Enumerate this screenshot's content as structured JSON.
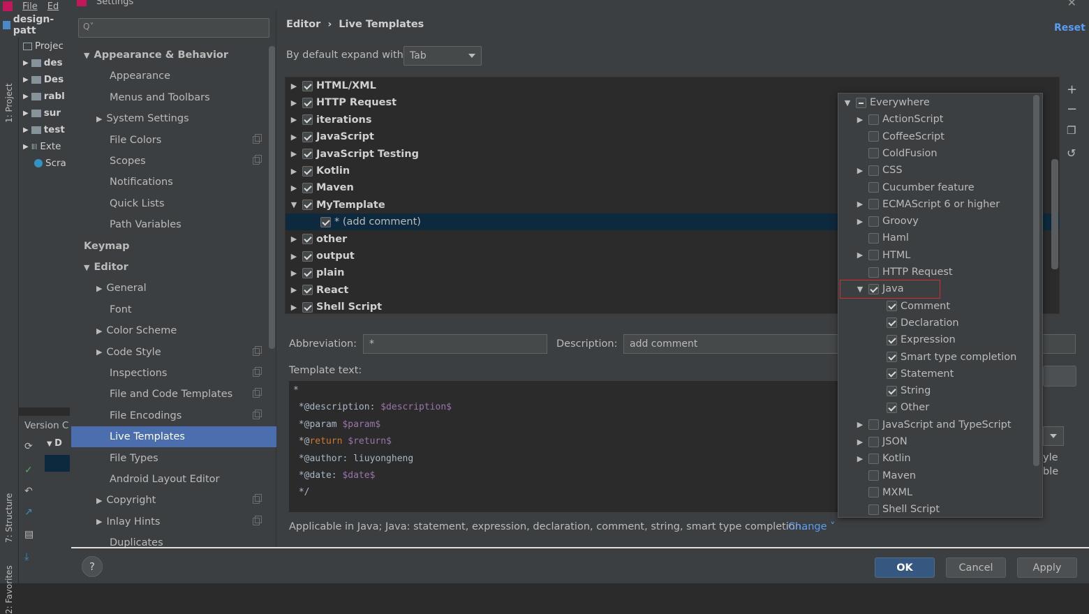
{
  "ide": {
    "menu": [
      "File",
      "Ed"
    ],
    "project_name": "design-patt",
    "stripe_project": "1: Project",
    "stripe_structure": "7: Structure",
    "stripe_favorites": "2: Favorites",
    "tree": [
      {
        "label": "Projec",
        "icon": "project-view-icon"
      },
      {
        "label": "des",
        "icon": "folder-icon"
      },
      {
        "label": "Des",
        "icon": "folder-icon"
      },
      {
        "label": "rabl",
        "icon": "folder-icon"
      },
      {
        "label": "sur",
        "icon": "folder-icon"
      },
      {
        "label": "test",
        "icon": "folder-icon"
      },
      {
        "label": "Exte",
        "icon": "library-icon"
      },
      {
        "label": "Scra",
        "icon": "scratches-icon"
      }
    ],
    "version_control": "Version C",
    "vc_row": "D"
  },
  "dialog": {
    "title": "Settings",
    "search": {
      "placeholder": "Q˅"
    },
    "nav": [
      {
        "label": "Appearance & Behavior",
        "level": 0,
        "bold": true,
        "arrow": "▼"
      },
      {
        "label": "Appearance",
        "level": 1
      },
      {
        "label": "Menus and Toolbars",
        "level": 1
      },
      {
        "label": "System Settings",
        "level": 1,
        "arrow": "▶"
      },
      {
        "label": "File Colors",
        "level": 1,
        "copy": true
      },
      {
        "label": "Scopes",
        "level": 1,
        "copy": true
      },
      {
        "label": "Notifications",
        "level": 1
      },
      {
        "label": "Quick Lists",
        "level": 1
      },
      {
        "label": "Path Variables",
        "level": 1
      },
      {
        "label": "Keymap",
        "level": 0,
        "bold": true
      },
      {
        "label": "Editor",
        "level": 0,
        "bold": true,
        "arrow": "▼"
      },
      {
        "label": "General",
        "level": 1,
        "arrow": "▶"
      },
      {
        "label": "Font",
        "level": 1
      },
      {
        "label": "Color Scheme",
        "level": 1,
        "arrow": "▶"
      },
      {
        "label": "Code Style",
        "level": 1,
        "arrow": "▶",
        "copy": true
      },
      {
        "label": "Inspections",
        "level": 1,
        "copy": true
      },
      {
        "label": "File and Code Templates",
        "level": 1,
        "copy": true
      },
      {
        "label": "File Encodings",
        "level": 1,
        "copy": true
      },
      {
        "label": "Live Templates",
        "level": 1,
        "selected": true
      },
      {
        "label": "File Types",
        "level": 1
      },
      {
        "label": "Android Layout Editor",
        "level": 1
      },
      {
        "label": "Copyright",
        "level": 1,
        "arrow": "▶",
        "copy": true
      },
      {
        "label": "Inlay Hints",
        "level": 1,
        "arrow": "▶",
        "copy": true
      },
      {
        "label": "Duplicates",
        "level": 1
      }
    ],
    "breadcrumb": {
      "parent": "Editor",
      "sep": "›",
      "current": "Live Templates"
    },
    "reset": "Reset",
    "expand_label": "By default expand with",
    "expand_value": "Tab",
    "templates": [
      {
        "label": "HTML/XML",
        "arrow": "▶"
      },
      {
        "label": "HTTP Request",
        "arrow": "▶"
      },
      {
        "label": "iterations",
        "arrow": "▶"
      },
      {
        "label": "JavaScript",
        "arrow": "▶"
      },
      {
        "label": "JavaScript Testing",
        "arrow": "▶"
      },
      {
        "label": "Kotlin",
        "arrow": "▶"
      },
      {
        "label": "Maven",
        "arrow": "▶"
      },
      {
        "label": "MyTemplate",
        "arrow": "▼"
      },
      {
        "label": "* (add comment)",
        "child": true
      },
      {
        "label": "other",
        "arrow": "▶"
      },
      {
        "label": "output",
        "arrow": "▶"
      },
      {
        "label": "plain",
        "arrow": "▶"
      },
      {
        "label": "React",
        "arrow": "▶"
      },
      {
        "label": "Shell Script",
        "arrow": "▶"
      }
    ],
    "tools": [
      "add-icon",
      "remove-icon",
      "copy-icon",
      "restore-icon"
    ],
    "abbreviation_label": "Abbreviation:",
    "abbreviation_value": "*",
    "description_label": "Description:",
    "description_value": "add comment",
    "template_text_label": "Template text:",
    "template_lines": [
      [
        {
          "t": "*"
        }
      ],
      [
        {
          "t": " *@description: "
        },
        {
          "t": "$description$",
          "c": "var"
        }
      ],
      [
        {
          "t": " *@param "
        },
        {
          "t": "$param$",
          "c": "var"
        }
      ],
      [
        {
          "t": " *@"
        },
        {
          "t": "return",
          "c": "kw"
        },
        {
          "t": " "
        },
        {
          "t": "$return$",
          "c": "var"
        }
      ],
      [
        {
          "t": " *@author: liuyongheng"
        }
      ],
      [
        {
          "t": " *@date: "
        },
        {
          "t": "$date$",
          "c": "var"
        }
      ],
      [
        {
          "t": " */"
        }
      ]
    ],
    "applicable": "Applicable in Java; Java: statement, expression, declaration, comment, string, smart type completion...",
    "change": "Change ˅",
    "right_fragments": [
      "yle",
      "ble"
    ],
    "buttons": {
      "help": "?",
      "ok": "OK",
      "cancel": "Cancel",
      "apply": "Apply"
    }
  },
  "contexts": [
    {
      "label": "Everywhere",
      "level": 0,
      "arrow": "▼",
      "state": "partial"
    },
    {
      "label": "ActionScript",
      "level": 1,
      "arrow": "▶",
      "state": "off"
    },
    {
      "label": "CoffeeScript",
      "level": 1,
      "state": "off"
    },
    {
      "label": "ColdFusion",
      "level": 1,
      "state": "off"
    },
    {
      "label": "CSS",
      "level": 1,
      "arrow": "▶",
      "state": "off"
    },
    {
      "label": "Cucumber feature",
      "level": 1,
      "state": "off"
    },
    {
      "label": "ECMAScript 6 or higher",
      "level": 1,
      "arrow": "▶",
      "state": "off"
    },
    {
      "label": "Groovy",
      "level": 1,
      "arrow": "▶",
      "state": "off"
    },
    {
      "label": "Haml",
      "level": 1,
      "state": "off"
    },
    {
      "label": "HTML",
      "level": 1,
      "arrow": "▶",
      "state": "off"
    },
    {
      "label": "HTTP Request",
      "level": 1,
      "state": "off"
    },
    {
      "label": "Java",
      "level": 1,
      "arrow": "▼",
      "state": "on"
    },
    {
      "label": "Comment",
      "level": 2,
      "state": "on"
    },
    {
      "label": "Declaration",
      "level": 2,
      "state": "on"
    },
    {
      "label": "Expression",
      "level": 2,
      "state": "on"
    },
    {
      "label": "Smart type completion",
      "level": 2,
      "state": "on"
    },
    {
      "label": "Statement",
      "level": 2,
      "state": "on"
    },
    {
      "label": "String",
      "level": 2,
      "state": "on"
    },
    {
      "label": "Other",
      "level": 2,
      "state": "on"
    },
    {
      "label": "JavaScript and TypeScript",
      "level": 1,
      "arrow": "▶",
      "state": "off"
    },
    {
      "label": "JSON",
      "level": 1,
      "arrow": "▶",
      "state": "off"
    },
    {
      "label": "Kotlin",
      "level": 1,
      "arrow": "▶",
      "state": "off"
    },
    {
      "label": "Maven",
      "level": 1,
      "state": "off"
    },
    {
      "label": "MXML",
      "level": 1,
      "state": "off"
    },
    {
      "label": "Shell Script",
      "level": 1,
      "state": "off"
    }
  ],
  "colors": {
    "selection": "#4b6eaf",
    "row_selection": "#0d293e",
    "link": "#589df6",
    "highlight_box": "#d32f2f",
    "primary_button": "#365880"
  }
}
